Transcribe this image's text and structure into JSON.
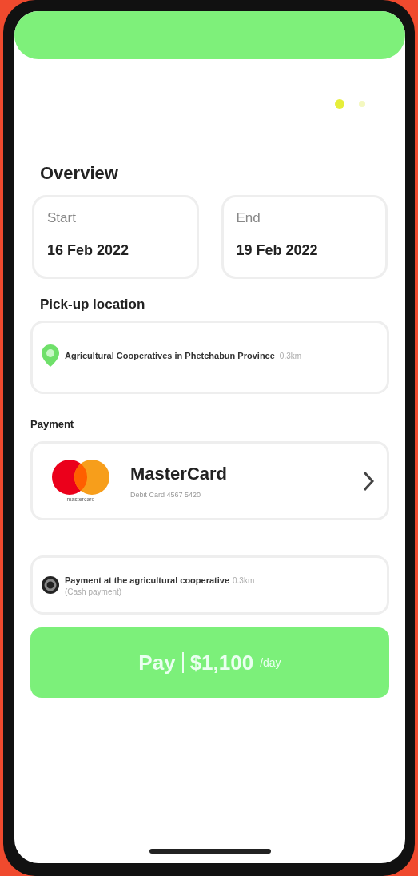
{
  "overview": {
    "title": "Overview",
    "start": {
      "label": "Start",
      "date": "16 Feb 2022"
    },
    "end": {
      "label": "End",
      "date": "19 Feb 2022"
    }
  },
  "pickup": {
    "title": "Pick-up location",
    "name": "Agricultural Cooperatives in Phetchabun Province",
    "distance": "0.3km"
  },
  "payment": {
    "title": "Payment",
    "card": {
      "logo_caption": "mastercard",
      "name": "MasterCard",
      "number": "Debit Card 4567 5420"
    },
    "alternative": {
      "name": "Payment at the agricultural cooperative",
      "distance": "0.3km",
      "note": "(Cash payment)"
    }
  },
  "pay_button": {
    "label": "Pay",
    "amount": "$1,100",
    "unit": "/day"
  }
}
